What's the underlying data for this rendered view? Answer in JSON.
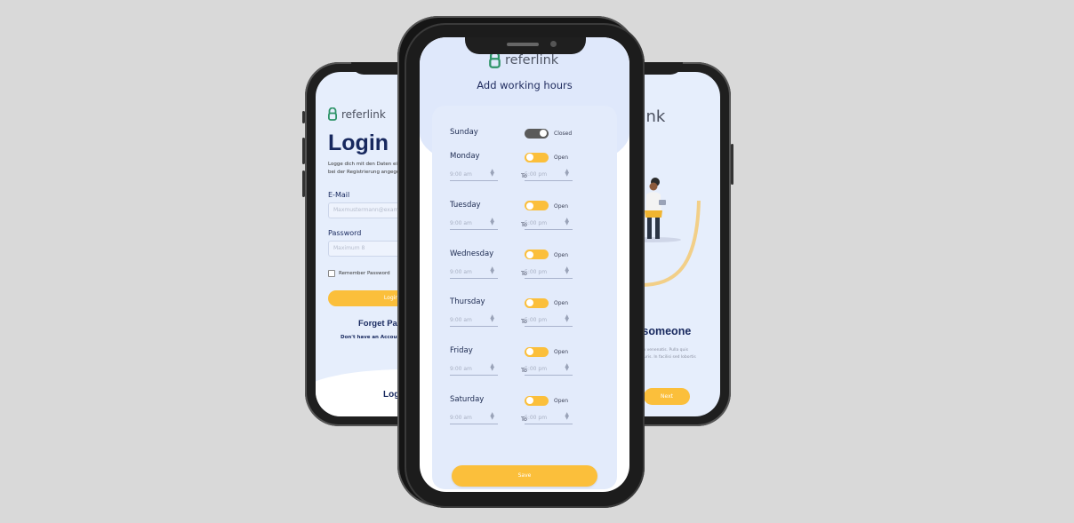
{
  "left_screen": {
    "brand": "referlink",
    "title": "Login",
    "description": "Logge dich mit den Daten ein, die du bei der Registrierung angegeben hast.",
    "email_label": "E-Mail",
    "email_placeholder": "Maxmustermann@example.de",
    "password_label": "Password",
    "password_placeholder": "Maximum 8",
    "remember_label": "Remember Password",
    "button_label": "Login",
    "forget_label": "Forget Password?",
    "no_account": "Don't have an Account?",
    "bottom_link": "Login"
  },
  "center_screen": {
    "brand": "referlink",
    "title": "Add working hours",
    "to_label": "To",
    "save_label": "Save",
    "days": [
      {
        "name": "Sunday",
        "state": "Closed",
        "open": false
      },
      {
        "name": "Monday",
        "state": "Open",
        "open": true,
        "from": "9:00 am",
        "to": "5:00 pm"
      },
      {
        "name": "Tuesday",
        "state": "Open",
        "open": true,
        "from": "9:00 am",
        "to": "5:00 pm"
      },
      {
        "name": "Wednesday",
        "state": "Open",
        "open": true,
        "from": "9:00 am",
        "to": "5:00 pm"
      },
      {
        "name": "Thursday",
        "state": "Open",
        "open": true,
        "from": "9:00 am",
        "to": "5:00 pm"
      },
      {
        "name": "Friday",
        "state": "Open",
        "open": true,
        "from": "9:00 am",
        "to": "5:00 pm"
      },
      {
        "name": "Saturday",
        "state": "Open",
        "open": true,
        "from": "9:00 am",
        "to": "5:00 pm"
      }
    ]
  },
  "right_screen": {
    "brand_fragment": "erlink",
    "heading": "efer someone",
    "body": "ofestra oreen venenatis. Pulla quis convallis mauris. In facilisi sed lobortis si.",
    "button_label": "Next"
  },
  "colors": {
    "background": "#d9d9d9",
    "accent_yellow": "#fbbf3b",
    "brand_green": "#2e9468",
    "navy": "#17285e",
    "card_blue": "#e3ebfb"
  }
}
